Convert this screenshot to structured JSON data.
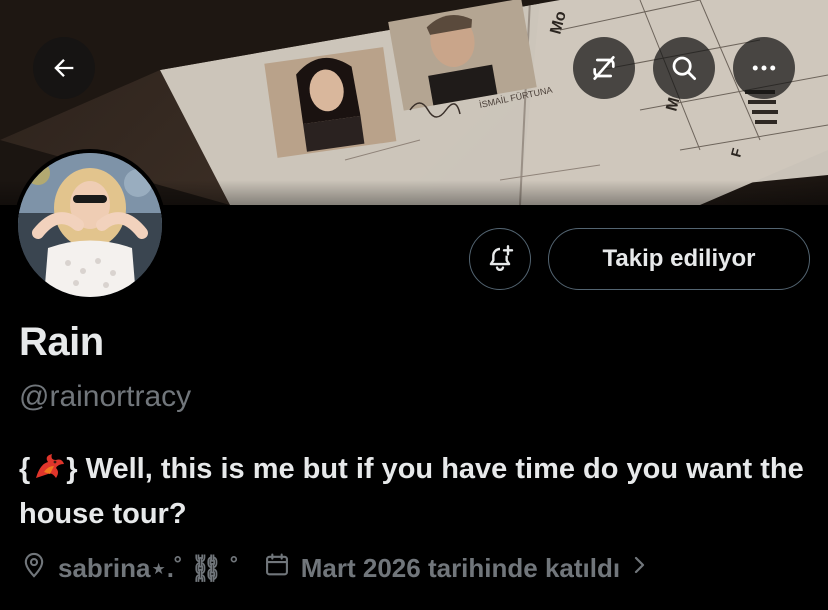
{
  "banner": {
    "photo_names": [
      "İSMAİL FÜRTUNA"
    ],
    "doc_letters": [
      "Mo",
      "M",
      "F"
    ]
  },
  "header": {
    "back_icon": "arrow-left-icon",
    "icons": [
      "repost-slash-icon",
      "search-icon",
      "more-icon"
    ]
  },
  "profile": {
    "display_name": "Rain",
    "handle": "@rainortracy",
    "bio_prefix": "{",
    "bio_suffix": "} Well, this is me but if you have time do you want the house tour?",
    "location": "sabrina⋆.˚ ⛓ ˚",
    "joined": "Mart 2026 tarihinde katıldı",
    "follow_label": "Takip ediliyor"
  },
  "colors": {
    "background": "#000000",
    "primary_text": "#e7e9ea",
    "secondary_text": "#71767b",
    "border": "#536471"
  }
}
